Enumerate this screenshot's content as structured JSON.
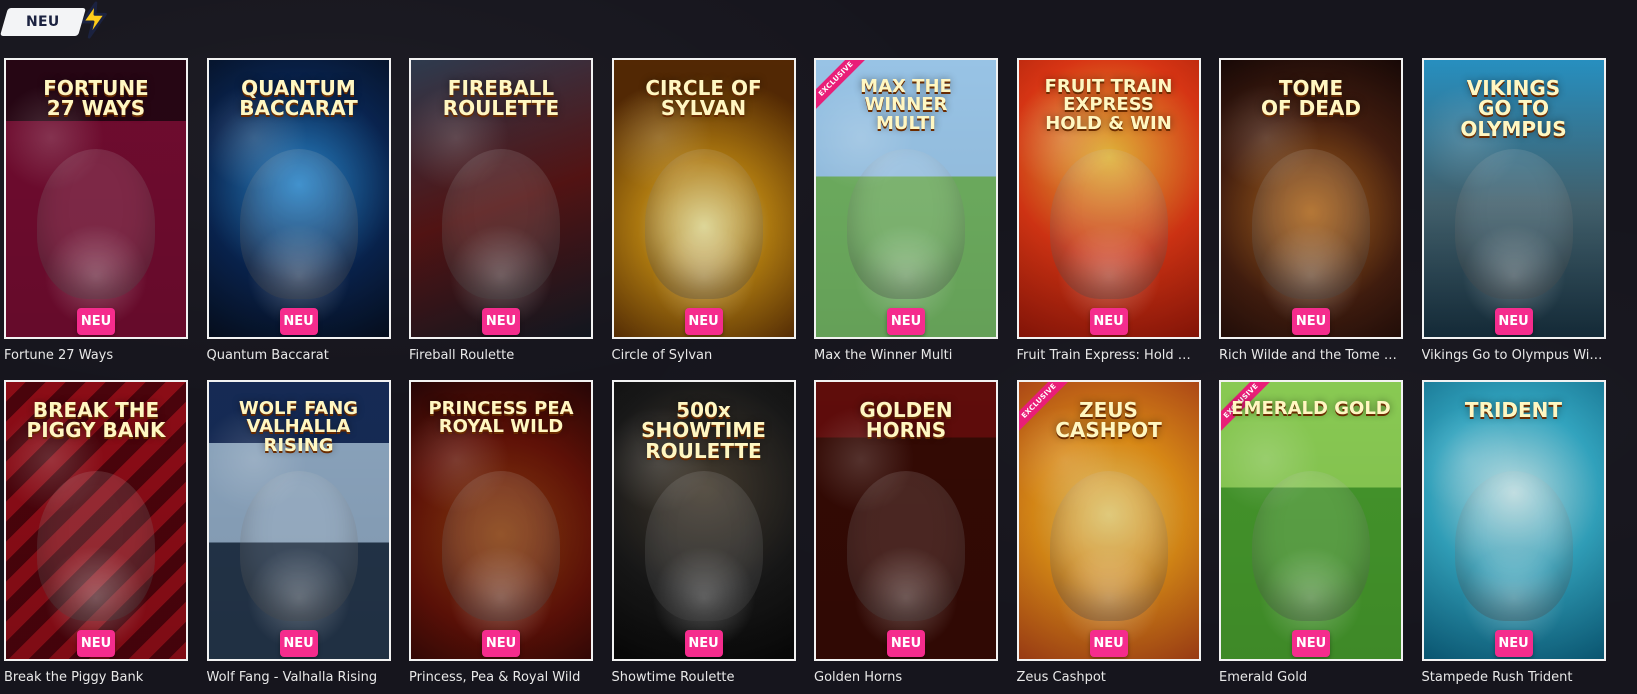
{
  "section": {
    "label": "NEU",
    "icon": "lightning-icon"
  },
  "colors": {
    "background": "#16151d",
    "badge": "#f52c8d",
    "tag": "#f3f4f6",
    "caption": "#e8e8e8"
  },
  "games": [
    {
      "name": "Fortune 27 Ways",
      "art": "FORTUNE\n27 WAYS",
      "badge": "NEU"
    },
    {
      "name": "Quantum Baccarat",
      "art": "QUANTUM\nBACCARAT",
      "badge": "NEU"
    },
    {
      "name": "Fireball Roulette",
      "art": "FIREBALL\nROULETTE",
      "badge": "NEU"
    },
    {
      "name": "Circle of Sylvan",
      "art": "CIRCLE OF\nSYLVAN",
      "badge": "NEU"
    },
    {
      "name": "Max the Winner Multi",
      "art": "MAX THE WINNER\nMULTI",
      "badge": "NEU",
      "exclusive": "EXCLUSIVE"
    },
    {
      "name": "Fruit Train Express: Hold & Win",
      "art": "FRUIT TRAIN\nEXPRESS\nHOLD & WIN",
      "badge": "NEU"
    },
    {
      "name": "Rich Wilde and the Tome of ...",
      "art": "TOME\nOF DEAD",
      "badge": "NEU"
    },
    {
      "name": "Vikings Go to Olympus Wild ...",
      "art": "VIKINGS\nGO TO\nOLYMPUS",
      "badge": "NEU"
    },
    {
      "name": "Break the Piggy Bank",
      "art": "BREAK THE\nPIGGY BANK",
      "badge": "NEU"
    },
    {
      "name": "Wolf Fang - Valhalla Rising",
      "art": "WOLF FANG\nVALHALLA RISING",
      "badge": "NEU"
    },
    {
      "name": "Princess, Pea & Royal Wild",
      "art": "PRINCESS PEA\nROYAL WILD",
      "badge": "NEU"
    },
    {
      "name": "Showtime Roulette",
      "art": "500x\nSHOWTIME\nROULETTE",
      "badge": "NEU"
    },
    {
      "name": "Golden Horns",
      "art": "GOLDEN\nHORNS",
      "badge": "NEU"
    },
    {
      "name": "Zeus Cashpot",
      "art": "ZEUS\nCASHPOT",
      "badge": "NEU",
      "exclusive": "EXCLUSIVE"
    },
    {
      "name": "Emerald Gold",
      "art": "EMERALD GOLD",
      "badge": "NEU",
      "exclusive": "EXCLUSIVE"
    },
    {
      "name": "Stampede Rush Trident",
      "art": "TRIDENT",
      "badge": "NEU"
    }
  ]
}
